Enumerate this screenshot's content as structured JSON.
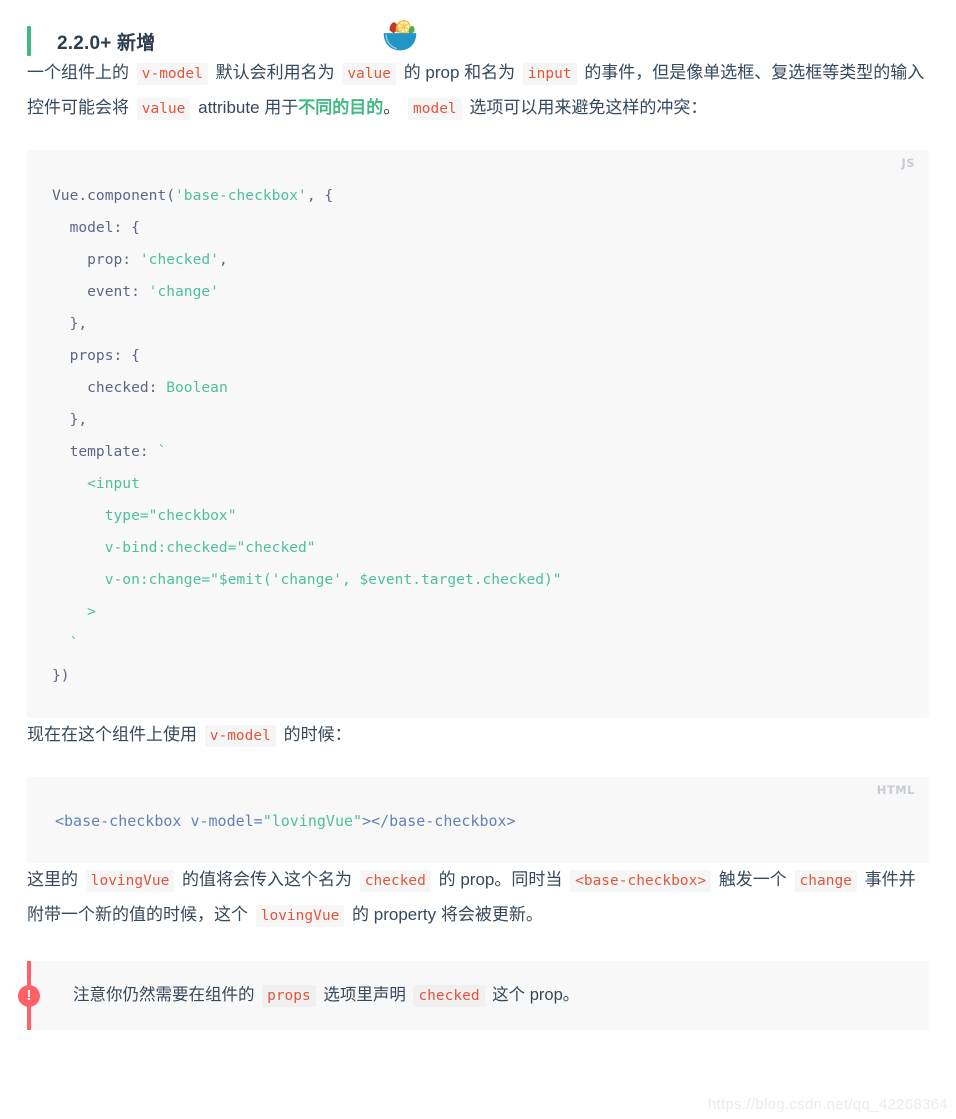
{
  "heading": {
    "badge_text": "2.2.0+ 新增",
    "accent_color": "#42b983",
    "emoji_name": "salad-bowl-emoji"
  },
  "paragraphs": {
    "intro": {
      "seg1": "一个组件上的",
      "code1": "v-model",
      "seg2": "默认会利用名为",
      "code2": "value",
      "seg3": "的 prop 和名为",
      "code3": "input",
      "seg4": "的事件，但是像单选框、复选框等类型的输入控件可能会将",
      "code4": "value",
      "seg5": "attribute 用于",
      "link": "不同的目的",
      "seg6": "。",
      "code5": "model",
      "seg7": "选项可以用来避免这样的冲突："
    },
    "usage": {
      "seg1": "现在在这个组件上使用",
      "code1": "v-model",
      "seg2": "的时候："
    },
    "explain": {
      "seg1": "这里的",
      "code1": "lovingVue",
      "seg2": "的值将会传入这个名为",
      "code2": "checked",
      "seg3": "的 prop。同时当",
      "code3": "<base-checkbox>",
      "seg4": "触发一个",
      "code4": "change",
      "seg5": "事件并附带一个新的值的时候，这个",
      "code5": "lovingVue",
      "seg6": "的 property 将会被更新。"
    }
  },
  "code_js": {
    "lang_label": "JS",
    "lines": [
      [
        {
          "t": "plain",
          "v": "Vue.component("
        },
        {
          "t": "str",
          "v": "'base-checkbox'"
        },
        {
          "t": "plain",
          "v": ", {"
        }
      ],
      [
        {
          "t": "plain",
          "v": "  model: {"
        }
      ],
      [
        {
          "t": "plain",
          "v": "    prop: "
        },
        {
          "t": "str",
          "v": "'checked'"
        },
        {
          "t": "plain",
          "v": ","
        }
      ],
      [
        {
          "t": "plain",
          "v": "    event: "
        },
        {
          "t": "str",
          "v": "'change'"
        }
      ],
      [
        {
          "t": "plain",
          "v": "  },"
        }
      ],
      [
        {
          "t": "plain",
          "v": "  props: {"
        }
      ],
      [
        {
          "t": "plain",
          "v": "    checked: "
        },
        {
          "t": "green",
          "v": "Boolean"
        }
      ],
      [
        {
          "t": "plain",
          "v": "  },"
        }
      ],
      [
        {
          "t": "plain",
          "v": "  template: "
        },
        {
          "t": "green",
          "v": "`"
        }
      ],
      [
        {
          "t": "green",
          "v": "    <input"
        }
      ],
      [
        {
          "t": "green",
          "v": "      type=\"checkbox\""
        }
      ],
      [
        {
          "t": "green",
          "v": "      v-bind:checked=\"checked\""
        }
      ],
      [
        {
          "t": "green",
          "v": "      v-on:change=\"$emit('change', $event.target.checked)\""
        }
      ],
      [
        {
          "t": "green",
          "v": "    >"
        }
      ],
      [
        {
          "t": "green",
          "v": "  `"
        }
      ],
      [
        {
          "t": "plain",
          "v": "})"
        }
      ]
    ]
  },
  "code_html": {
    "lang_label": "HTML",
    "lines": [
      [
        {
          "t": "tag",
          "v": "<base-checkbox "
        },
        {
          "t": "attr",
          "v": "v-model="
        },
        {
          "t": "val",
          "v": "\"lovingVue\""
        },
        {
          "t": "tag",
          "v": "></base-checkbox>"
        }
      ]
    ]
  },
  "tip": {
    "icon_char": "!",
    "accent_color": "#ff6166",
    "seg1": "注意你仍然需要在组件的",
    "code1": "props",
    "seg2": "选项里声明",
    "code2": "checked",
    "seg3": "这个 prop。"
  },
  "watermark": {
    "text": "https://blog.csdn.net/qq_42268364"
  }
}
